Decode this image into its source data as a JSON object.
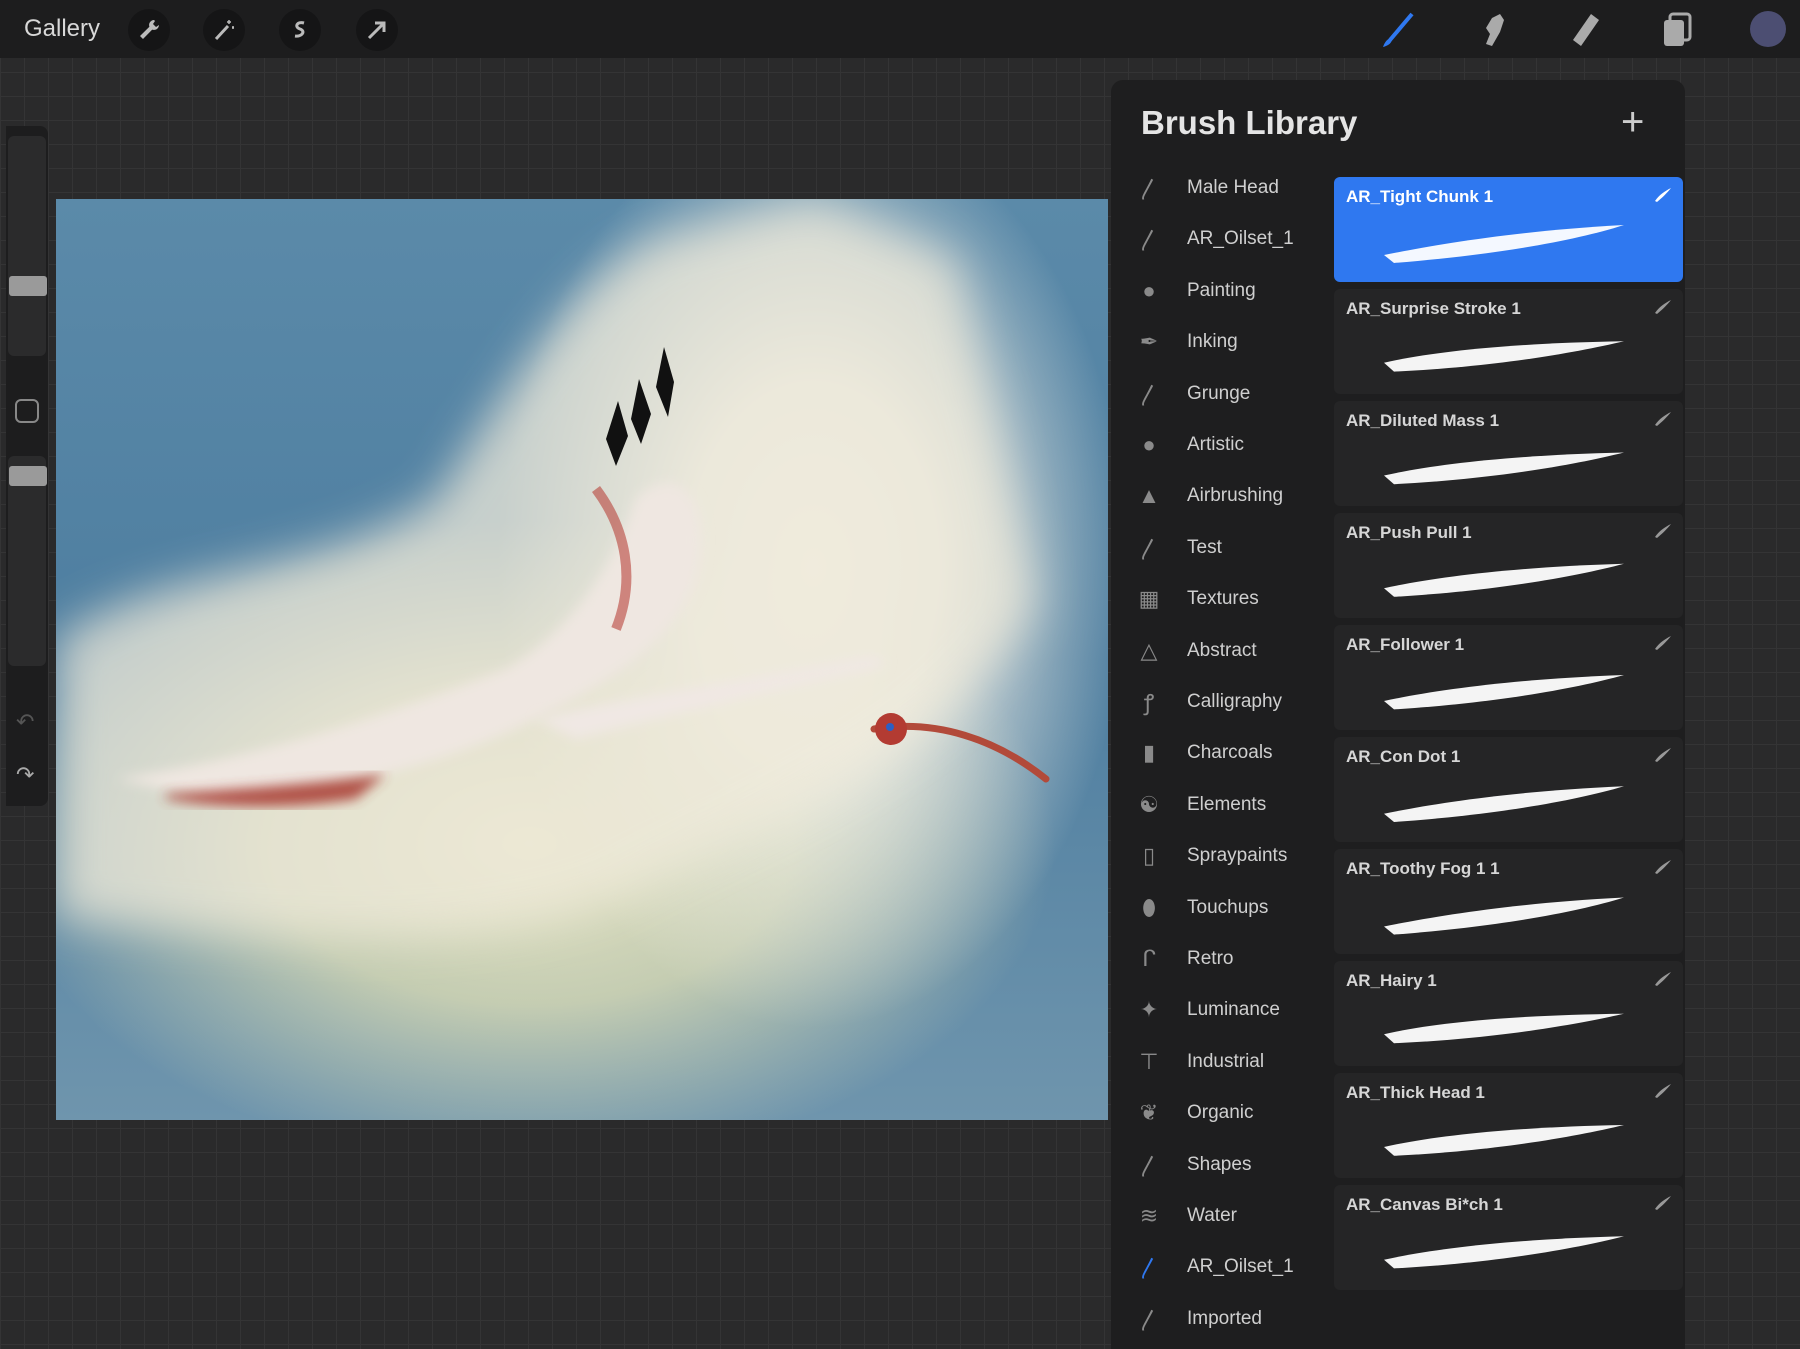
{
  "topbar": {
    "gallery": "Gallery",
    "left_tools": [
      "wrench-icon",
      "magic-wand-icon",
      "selection-icon",
      "transform-arrow-icon"
    ],
    "right_tools": [
      "brush-icon",
      "smudge-icon",
      "eraser-icon",
      "layers-icon"
    ],
    "active_tool": "brush",
    "active_color": "#4c4e72",
    "accent": "#2f78f0"
  },
  "panel": {
    "title": "Brush Library",
    "add": "+",
    "categories": [
      {
        "label": "Male Head",
        "icon": "brush-stroke-icon"
      },
      {
        "label": "AR_Oilset_1",
        "icon": "brush-stroke-icon"
      },
      {
        "label": "Painting",
        "icon": "drop-icon"
      },
      {
        "label": "Inking",
        "icon": "pen-nib-icon"
      },
      {
        "label": "Grunge",
        "icon": "brush-stroke-icon"
      },
      {
        "label": "Artistic",
        "icon": "drop-icon"
      },
      {
        "label": "Airbrushing",
        "icon": "airbrush-icon"
      },
      {
        "label": "Test",
        "icon": "brush-stroke-icon"
      },
      {
        "label": "Textures",
        "icon": "checker-icon"
      },
      {
        "label": "Abstract",
        "icon": "triangle-icon"
      },
      {
        "label": "Calligraphy",
        "icon": "calligraphy-icon"
      },
      {
        "label": "Charcoals",
        "icon": "charcoal-icon"
      },
      {
        "label": "Elements",
        "icon": "yin-yang-icon"
      },
      {
        "label": "Spraypaints",
        "icon": "spray-can-icon"
      },
      {
        "label": "Touchups",
        "icon": "touchup-icon"
      },
      {
        "label": "Retro",
        "icon": "retro-icon"
      },
      {
        "label": "Luminance",
        "icon": "sparkle-icon"
      },
      {
        "label": "Industrial",
        "icon": "anvil-icon"
      },
      {
        "label": "Organic",
        "icon": "leaf-icon"
      },
      {
        "label": "Shapes",
        "icon": "brush-stroke-icon"
      },
      {
        "label": "Water",
        "icon": "waves-icon"
      },
      {
        "label": "AR_Oilset_1",
        "icon": "brush-stroke-icon",
        "active": true
      },
      {
        "label": "Imported",
        "icon": "brush-stroke-icon"
      }
    ],
    "brushes": [
      {
        "name": "AR_Tight Chunk 1",
        "selected": true
      },
      {
        "name": "AR_Surprise Stroke 1"
      },
      {
        "name": "AR_Diluted Mass 1"
      },
      {
        "name": "AR_Push Pull 1"
      },
      {
        "name": "AR_Follower 1"
      },
      {
        "name": "AR_Con Dot 1"
      },
      {
        "name": "AR_Toothy Fog 1 1"
      },
      {
        "name": "AR_Hairy 1"
      },
      {
        "name": "AR_Thick Head 1"
      },
      {
        "name": "AR_Canvas Bi*ch 1"
      }
    ]
  }
}
